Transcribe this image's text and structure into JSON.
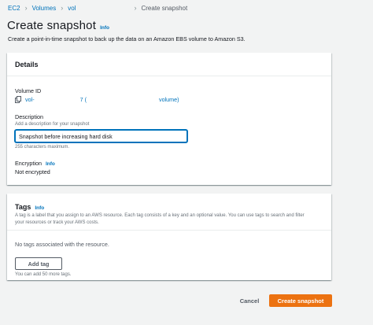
{
  "breadcrumb": {
    "items": [
      "EC2",
      "Volumes",
      "vol",
      "Create snapshot"
    ]
  },
  "header": {
    "title": "Create snapshot",
    "info": "Info",
    "subtitle": "Create a point-in-time snapshot to back up the data on an Amazon EBS volume to Amazon S3."
  },
  "details": {
    "title": "Details",
    "volume_id_label": "Volume ID",
    "volume_id_prefix": "vol-",
    "volume_id_mid": "7 (",
    "volume_id_suffix": "volume)",
    "description_label": "Description",
    "description_hint": "Add a description for your snapshot",
    "description_value": "Snapshot before increasing hard disk",
    "description_constraint": "255 characters maximum.",
    "encryption_label": "Encryption",
    "encryption_info": "Info",
    "encryption_value": "Not encrypted"
  },
  "tags": {
    "title": "Tags",
    "info": "Info",
    "description_line1": "A tag is a label that you assign to an AWS resource. Each tag consists of a key and an optional value. You can use tags to search and filter",
    "description_line2": "your resources or track your AWS costs.",
    "empty_message": "No tags associated with the resource.",
    "add_button": "Add tag",
    "limit_note": "You can add 50 more tags."
  },
  "footer": {
    "cancel": "Cancel",
    "submit": "Create snapshot"
  },
  "colors": {
    "primary": "#ec7211",
    "link": "#0073bb",
    "background": "#f2f3f3"
  }
}
